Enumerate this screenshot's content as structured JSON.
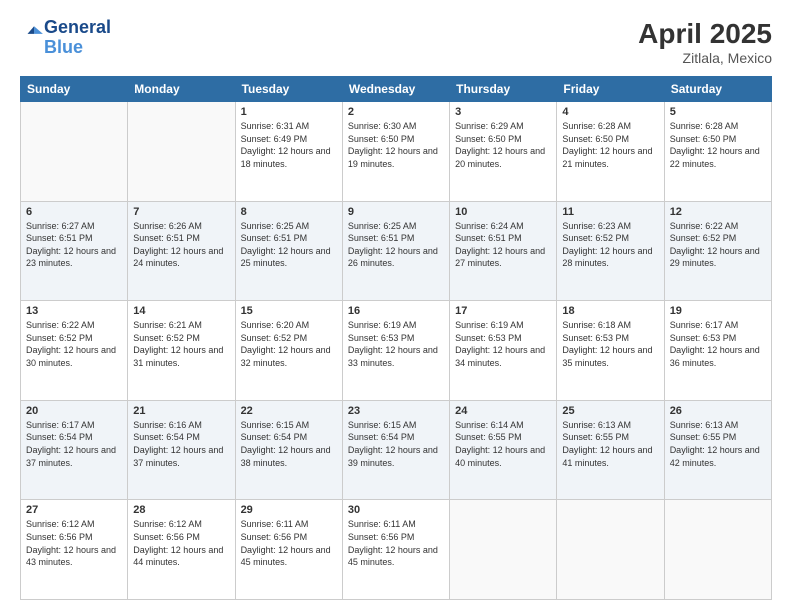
{
  "header": {
    "logo_line1": "General",
    "logo_line2": "Blue",
    "title": "April 2025",
    "location": "Zitlala, Mexico"
  },
  "columns": [
    "Sunday",
    "Monday",
    "Tuesday",
    "Wednesday",
    "Thursday",
    "Friday",
    "Saturday"
  ],
  "weeks": [
    {
      "days": [
        {
          "num": "",
          "info": ""
        },
        {
          "num": "",
          "info": ""
        },
        {
          "num": "1",
          "info": "Sunrise: 6:31 AM\nSunset: 6:49 PM\nDaylight: 12 hours and 18 minutes."
        },
        {
          "num": "2",
          "info": "Sunrise: 6:30 AM\nSunset: 6:50 PM\nDaylight: 12 hours and 19 minutes."
        },
        {
          "num": "3",
          "info": "Sunrise: 6:29 AM\nSunset: 6:50 PM\nDaylight: 12 hours and 20 minutes."
        },
        {
          "num": "4",
          "info": "Sunrise: 6:28 AM\nSunset: 6:50 PM\nDaylight: 12 hours and 21 minutes."
        },
        {
          "num": "5",
          "info": "Sunrise: 6:28 AM\nSunset: 6:50 PM\nDaylight: 12 hours and 22 minutes."
        }
      ]
    },
    {
      "days": [
        {
          "num": "6",
          "info": "Sunrise: 6:27 AM\nSunset: 6:51 PM\nDaylight: 12 hours and 23 minutes."
        },
        {
          "num": "7",
          "info": "Sunrise: 6:26 AM\nSunset: 6:51 PM\nDaylight: 12 hours and 24 minutes."
        },
        {
          "num": "8",
          "info": "Sunrise: 6:25 AM\nSunset: 6:51 PM\nDaylight: 12 hours and 25 minutes."
        },
        {
          "num": "9",
          "info": "Sunrise: 6:25 AM\nSunset: 6:51 PM\nDaylight: 12 hours and 26 minutes."
        },
        {
          "num": "10",
          "info": "Sunrise: 6:24 AM\nSunset: 6:51 PM\nDaylight: 12 hours and 27 minutes."
        },
        {
          "num": "11",
          "info": "Sunrise: 6:23 AM\nSunset: 6:52 PM\nDaylight: 12 hours and 28 minutes."
        },
        {
          "num": "12",
          "info": "Sunrise: 6:22 AM\nSunset: 6:52 PM\nDaylight: 12 hours and 29 minutes."
        }
      ]
    },
    {
      "days": [
        {
          "num": "13",
          "info": "Sunrise: 6:22 AM\nSunset: 6:52 PM\nDaylight: 12 hours and 30 minutes."
        },
        {
          "num": "14",
          "info": "Sunrise: 6:21 AM\nSunset: 6:52 PM\nDaylight: 12 hours and 31 minutes."
        },
        {
          "num": "15",
          "info": "Sunrise: 6:20 AM\nSunset: 6:52 PM\nDaylight: 12 hours and 32 minutes."
        },
        {
          "num": "16",
          "info": "Sunrise: 6:19 AM\nSunset: 6:53 PM\nDaylight: 12 hours and 33 minutes."
        },
        {
          "num": "17",
          "info": "Sunrise: 6:19 AM\nSunset: 6:53 PM\nDaylight: 12 hours and 34 minutes."
        },
        {
          "num": "18",
          "info": "Sunrise: 6:18 AM\nSunset: 6:53 PM\nDaylight: 12 hours and 35 minutes."
        },
        {
          "num": "19",
          "info": "Sunrise: 6:17 AM\nSunset: 6:53 PM\nDaylight: 12 hours and 36 minutes."
        }
      ]
    },
    {
      "days": [
        {
          "num": "20",
          "info": "Sunrise: 6:17 AM\nSunset: 6:54 PM\nDaylight: 12 hours and 37 minutes."
        },
        {
          "num": "21",
          "info": "Sunrise: 6:16 AM\nSunset: 6:54 PM\nDaylight: 12 hours and 37 minutes."
        },
        {
          "num": "22",
          "info": "Sunrise: 6:15 AM\nSunset: 6:54 PM\nDaylight: 12 hours and 38 minutes."
        },
        {
          "num": "23",
          "info": "Sunrise: 6:15 AM\nSunset: 6:54 PM\nDaylight: 12 hours and 39 minutes."
        },
        {
          "num": "24",
          "info": "Sunrise: 6:14 AM\nSunset: 6:55 PM\nDaylight: 12 hours and 40 minutes."
        },
        {
          "num": "25",
          "info": "Sunrise: 6:13 AM\nSunset: 6:55 PM\nDaylight: 12 hours and 41 minutes."
        },
        {
          "num": "26",
          "info": "Sunrise: 6:13 AM\nSunset: 6:55 PM\nDaylight: 12 hours and 42 minutes."
        }
      ]
    },
    {
      "days": [
        {
          "num": "27",
          "info": "Sunrise: 6:12 AM\nSunset: 6:56 PM\nDaylight: 12 hours and 43 minutes."
        },
        {
          "num": "28",
          "info": "Sunrise: 6:12 AM\nSunset: 6:56 PM\nDaylight: 12 hours and 44 minutes."
        },
        {
          "num": "29",
          "info": "Sunrise: 6:11 AM\nSunset: 6:56 PM\nDaylight: 12 hours and 45 minutes."
        },
        {
          "num": "30",
          "info": "Sunrise: 6:11 AM\nSunset: 6:56 PM\nDaylight: 12 hours and 45 minutes."
        },
        {
          "num": "",
          "info": ""
        },
        {
          "num": "",
          "info": ""
        },
        {
          "num": "",
          "info": ""
        }
      ]
    }
  ]
}
